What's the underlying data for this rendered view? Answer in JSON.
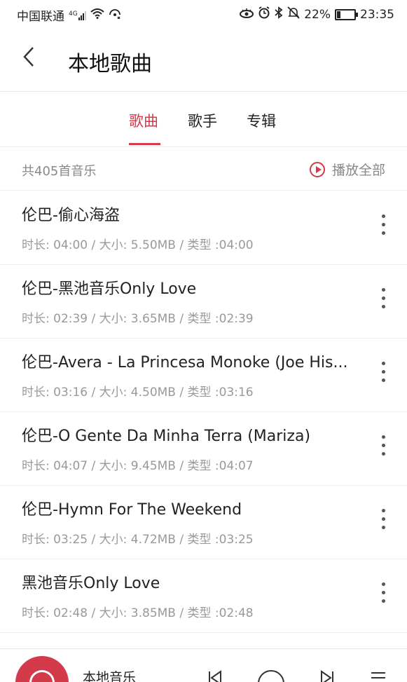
{
  "statusbar": {
    "carrier": "中国联通",
    "network": "4G",
    "battery_pct": "22%",
    "battery_level": 0.22,
    "time": "23:35",
    "icons": [
      "signal-icon",
      "wifi-icon",
      "hotspot-icon",
      "eye-icon",
      "alarm-icon",
      "bluetooth-icon",
      "mute-icon",
      "battery-icon"
    ]
  },
  "header": {
    "title": "本地歌曲",
    "back_icon": "chevron-left-icon"
  },
  "tabs": [
    {
      "label": "歌曲",
      "active": true
    },
    {
      "label": "歌手",
      "active": false
    },
    {
      "label": "专辑",
      "active": false
    }
  ],
  "summary": {
    "count_text": "共405首音乐",
    "play_all": "播放全部"
  },
  "songs": [
    {
      "name": "伦巴-偷心海盗",
      "meta": "时长: 04:00 / 大小: 5.50MB / 类型 :04:00"
    },
    {
      "name": "伦巴-黑池音乐Only Love",
      "meta": "时长: 02:39 / 大小: 3.65MB / 类型 :02:39"
    },
    {
      "name": "伦巴-Avera - La Princesa Monoke (Joe His...",
      "meta": "时长: 03:16 / 大小: 4.50MB / 类型 :03:16"
    },
    {
      "name": "伦巴-O Gente Da Minha Terra (Mariza)",
      "meta": "时长: 04:07 / 大小: 9.45MB / 类型 :04:07"
    },
    {
      "name": "伦巴-Hymn For The Weekend",
      "meta": "时长: 03:25 / 大小: 4.72MB / 类型 :03:25"
    },
    {
      "name": "黑池音乐Only Love",
      "meta": "时长: 02:48 / 大小: 3.85MB / 类型 :02:48"
    }
  ],
  "player": {
    "title": "本地音乐"
  },
  "colors": {
    "accent": "#d33a4a",
    "secondary_text": "#999999"
  }
}
